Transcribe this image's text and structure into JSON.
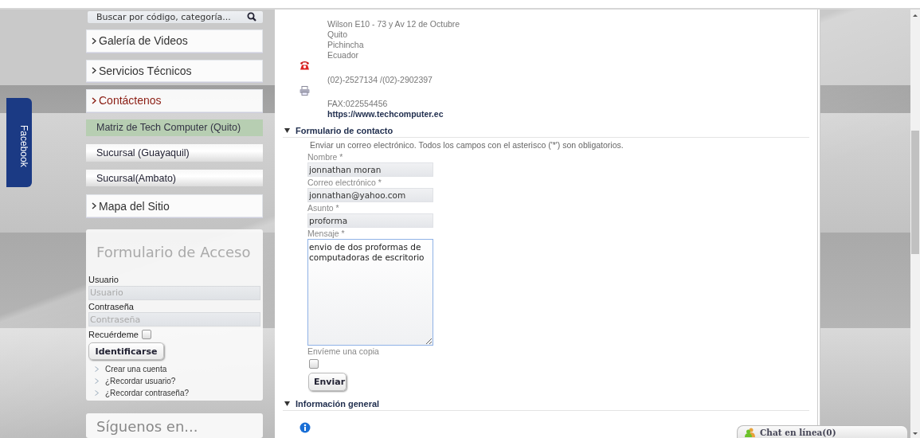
{
  "facebook_tab": {
    "label": "Facebook"
  },
  "search": {
    "placeholder": "Buscar por código, categoría..."
  },
  "menu": [
    {
      "label": "Galería de Videos",
      "kind": "main",
      "selected": false
    },
    {
      "label": "Servicios Técnicos",
      "kind": "main",
      "selected": false
    },
    {
      "label": "Contáctenos",
      "kind": "main",
      "selected": true
    },
    {
      "label": "Matriz de Tech Computer (Quito)",
      "kind": "sub",
      "selected": true
    },
    {
      "label": "Sucursal (Guayaquil)",
      "kind": "sub",
      "selected": false
    },
    {
      "label": "Sucursal(Ambato)",
      "kind": "sub",
      "selected": false
    },
    {
      "label": "Mapa del Sitio",
      "kind": "main",
      "selected": false
    }
  ],
  "login": {
    "title": "Formulario de Acceso",
    "fields": [
      {
        "label": "Usuario",
        "placeholder": "Usuario"
      },
      {
        "label": "Contraseña",
        "placeholder": "Contraseña"
      }
    ],
    "remember": {
      "label": "Recuérdeme",
      "checked": false
    },
    "button": "Identificarse",
    "links": [
      "Crear una cuenta",
      "¿Recordar usuario?",
      "¿Recordar contraseña?"
    ]
  },
  "follow": {
    "title": "Síguenos en..."
  },
  "contact": {
    "address_lines": [
      "Wilson E10 - 73 y Av 12 de Octubre",
      "Quito",
      "Pichincha",
      "Ecuador"
    ],
    "phone": "(02)-2527134 /(02)-2902397",
    "fax": "FAX:022554456",
    "website": "https://www.techcomputer.ec"
  },
  "contact_form": {
    "title": "Formulario de contacto",
    "expanded": true,
    "intro": "Enviar un correo electrónico. Todos los campos con el asterisco ('*') son obligatorios.",
    "fields": [
      {
        "label": "Nombre *",
        "value": "jonnathan moran",
        "kind": "text"
      },
      {
        "label": "Correo electrónico *",
        "value": "jonnathan@yahoo.com",
        "kind": "text"
      },
      {
        "label": "Asunto *",
        "value": "proforma",
        "kind": "text"
      },
      {
        "label": "Mensaje *",
        "value": "envio de dos proformas de computadoras de escritorio",
        "kind": "textarea"
      }
    ],
    "copy": {
      "label": "Envíeme una copia",
      "checked": false
    },
    "submit": "Enviar"
  },
  "general_info": {
    "title": "Información general",
    "expanded": true
  },
  "chat": {
    "label": "Chat en línea(0)"
  }
}
